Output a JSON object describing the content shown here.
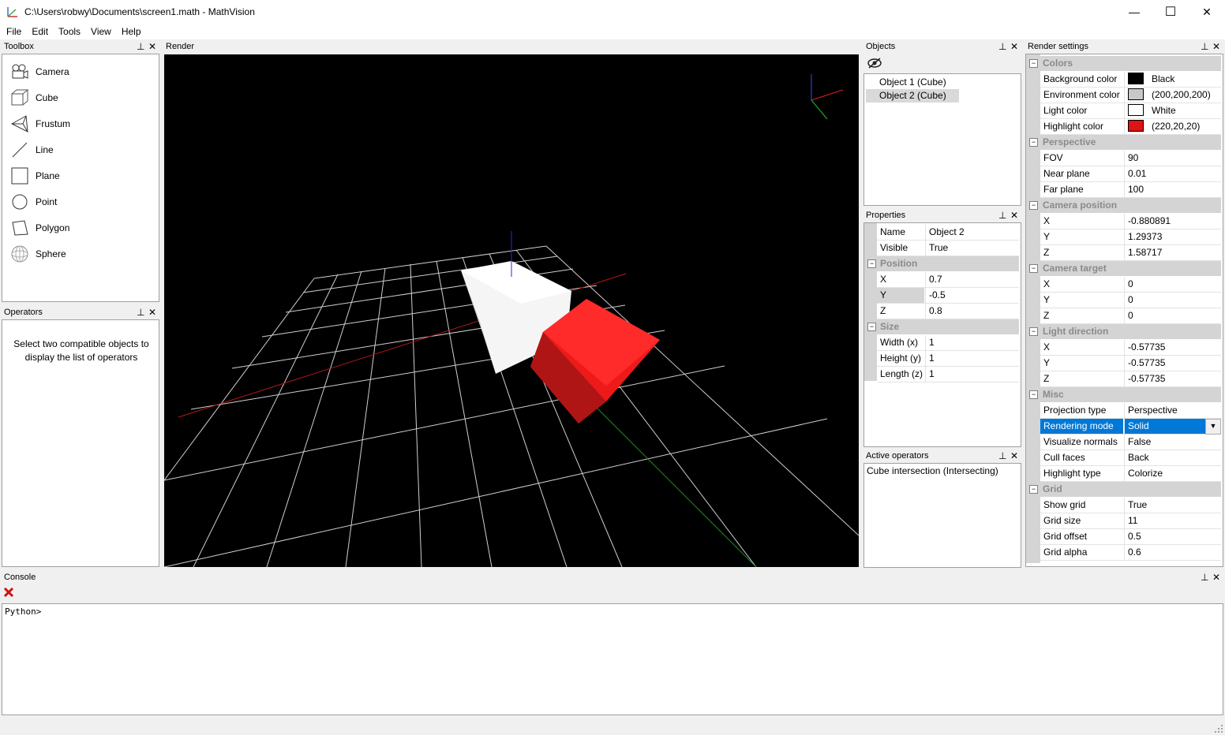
{
  "window": {
    "title": "C:\\Users\\robwy\\Documents\\screen1.math - MathVision",
    "minimize": "—",
    "maximize": "☐",
    "close": "✕"
  },
  "menu": [
    "File",
    "Edit",
    "Tools",
    "View",
    "Help"
  ],
  "panels": {
    "toolbox": "Toolbox",
    "operators": "Operators",
    "render": "Render",
    "objects": "Objects",
    "properties": "Properties",
    "active_operators": "Active operators",
    "render_settings": "Render settings",
    "console": "Console"
  },
  "toolbox": [
    {
      "label": "Camera",
      "icon": "camera-icon"
    },
    {
      "label": "Cube",
      "icon": "cube-icon"
    },
    {
      "label": "Frustum",
      "icon": "frustum-icon"
    },
    {
      "label": "Line",
      "icon": "line-icon"
    },
    {
      "label": "Plane",
      "icon": "plane-icon"
    },
    {
      "label": "Point",
      "icon": "point-icon"
    },
    {
      "label": "Polygon",
      "icon": "polygon-icon"
    },
    {
      "label": "Sphere",
      "icon": "sphere-icon"
    }
  ],
  "operators_message": "Select two compatible objects to display the list of operators",
  "objects": {
    "items": [
      "Object 1 (Cube)",
      "Object 2 (Cube)"
    ],
    "selected_index": 1
  },
  "properties": {
    "name_label": "Name",
    "name_value": "Object 2",
    "visible_label": "Visible",
    "visible_value": "True",
    "position_cat": "Position",
    "x_label": "X",
    "x_value": "0.7",
    "y_label": "Y",
    "y_value": "-0.5",
    "z_label": "Z",
    "z_value": "0.8",
    "size_cat": "Size",
    "w_label": "Width (x)",
    "w_value": "1",
    "h_label": "Height (y)",
    "h_value": "1",
    "l_label": "Length (z)",
    "l_value": "1"
  },
  "active_operators": [
    "Cube intersection (Intersecting)"
  ],
  "render_settings": {
    "colors_cat": "Colors",
    "bg_label": "Background color",
    "bg_value": "Black",
    "bg_color": "#000000",
    "env_label": "Environment color",
    "env_value": "(200,200,200)",
    "env_color": "#c8c8c8",
    "light_label": "Light color",
    "light_value": "White",
    "light_color": "#ffffff",
    "hl_label": "Highlight color",
    "hl_value": "(220,20,20)",
    "hl_color": "#dc1414",
    "persp_cat": "Perspective",
    "fov_label": "FOV",
    "fov_value": "90",
    "near_label": "Near plane",
    "near_value": "0.01",
    "far_label": "Far plane",
    "far_value": "100",
    "campos_cat": "Camera position",
    "cp_x_label": "X",
    "cp_x": "-0.880891",
    "cp_y_label": "Y",
    "cp_y": "1.29373",
    "cp_z_label": "Z",
    "cp_z": "1.58717",
    "camtgt_cat": "Camera target",
    "ct_x_label": "X",
    "ct_x": "0",
    "ct_y_label": "Y",
    "ct_y": "0",
    "ct_z_label": "Z",
    "ct_z": "0",
    "lightdir_cat": "Light direction",
    "ld_x_label": "X",
    "ld_x": "-0.57735",
    "ld_y_label": "Y",
    "ld_y": "-0.57735",
    "ld_z_label": "Z",
    "ld_z": "-0.57735",
    "misc_cat": "Misc",
    "proj_label": "Projection type",
    "proj_value": "Perspective",
    "rmode_label": "Rendering mode",
    "rmode_value": "Solid",
    "vnorm_label": "Visualize normals",
    "vnorm_value": "False",
    "cull_label": "Cull faces",
    "cull_value": "Back",
    "htype_label": "Highlight type",
    "htype_value": "Colorize",
    "grid_cat": "Grid",
    "showgrid_label": "Show grid",
    "showgrid_value": "True",
    "gsize_label": "Grid size",
    "gsize_value": "11",
    "goffset_label": "Grid offset",
    "goffset_value": "0.5",
    "galpha_label": "Grid alpha",
    "galpha_value": "0.6"
  },
  "console": {
    "prompt": "Python>"
  }
}
